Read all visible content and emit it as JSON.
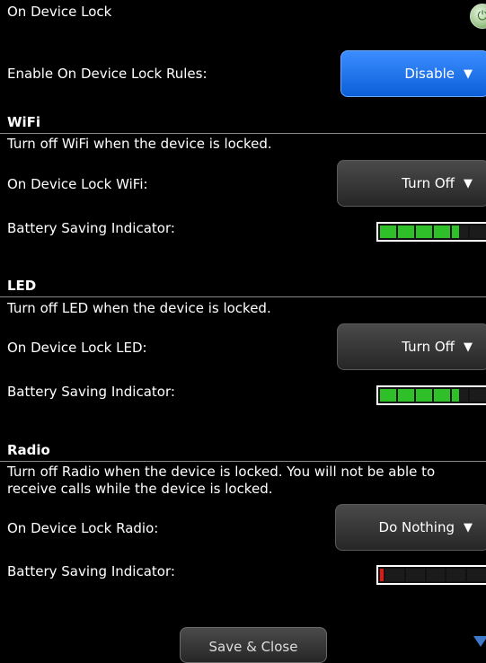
{
  "header": {
    "title": "On Device Lock",
    "plugin_icon": "power-plug-icon"
  },
  "rules": {
    "label": "Enable On Device Lock Rules:",
    "value": "Disable"
  },
  "wifi": {
    "heading": "WiFi",
    "description": "Turn off WiFi when the device is locked.",
    "label": "On Device Lock WiFi:",
    "value": "Turn Off",
    "battery_label": "Battery Saving Indicator:",
    "battery_level": 4.5,
    "battery_max": 6
  },
  "led": {
    "heading": "LED",
    "description": "Turn off LED when the device is locked.",
    "label": "On Device Lock LED:",
    "value": "Turn Off",
    "battery_label": "Battery Saving Indicator:",
    "battery_level": 4.5,
    "battery_max": 6
  },
  "radio": {
    "heading": "Radio",
    "description": "Turn off Radio when the device is locked. You will not be able to receive calls while the device is locked.",
    "label": "On Device Lock Radio:",
    "value": "Do Nothing",
    "battery_label": "Battery Saving Indicator:",
    "battery_level": 0.2,
    "battery_max": 6
  },
  "footer": {
    "save_label": "Save & Close"
  },
  "colors": {
    "accent": "#0d5fd8",
    "meter_on": "#2fbf28",
    "meter_low": "#e01818"
  }
}
